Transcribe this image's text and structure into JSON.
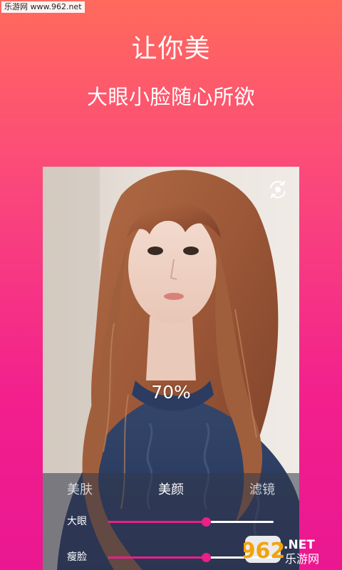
{
  "watermark_top": "乐游网 www.962.net",
  "headline": "让你美",
  "subheadline": "大眼小脸随心所欲",
  "preview": {
    "percent_text": "70%",
    "rotate_icon": "rotate-camera-icon"
  },
  "tabs": [
    {
      "label": "美肤",
      "active": false
    },
    {
      "label": "美颜",
      "active": true
    },
    {
      "label": "滤镜",
      "active": false
    }
  ],
  "sliders": [
    {
      "label": "大眼",
      "value": 0.59
    },
    {
      "label": "瘦脸",
      "value": 0.59
    }
  ],
  "logo": {
    "text": "962",
    "suffix": ".NET",
    "sub": "乐游网"
  },
  "colors": {
    "accent": "#ea1f88",
    "bg_top": "#ff6a5c",
    "bg_bottom": "#ea1791"
  }
}
